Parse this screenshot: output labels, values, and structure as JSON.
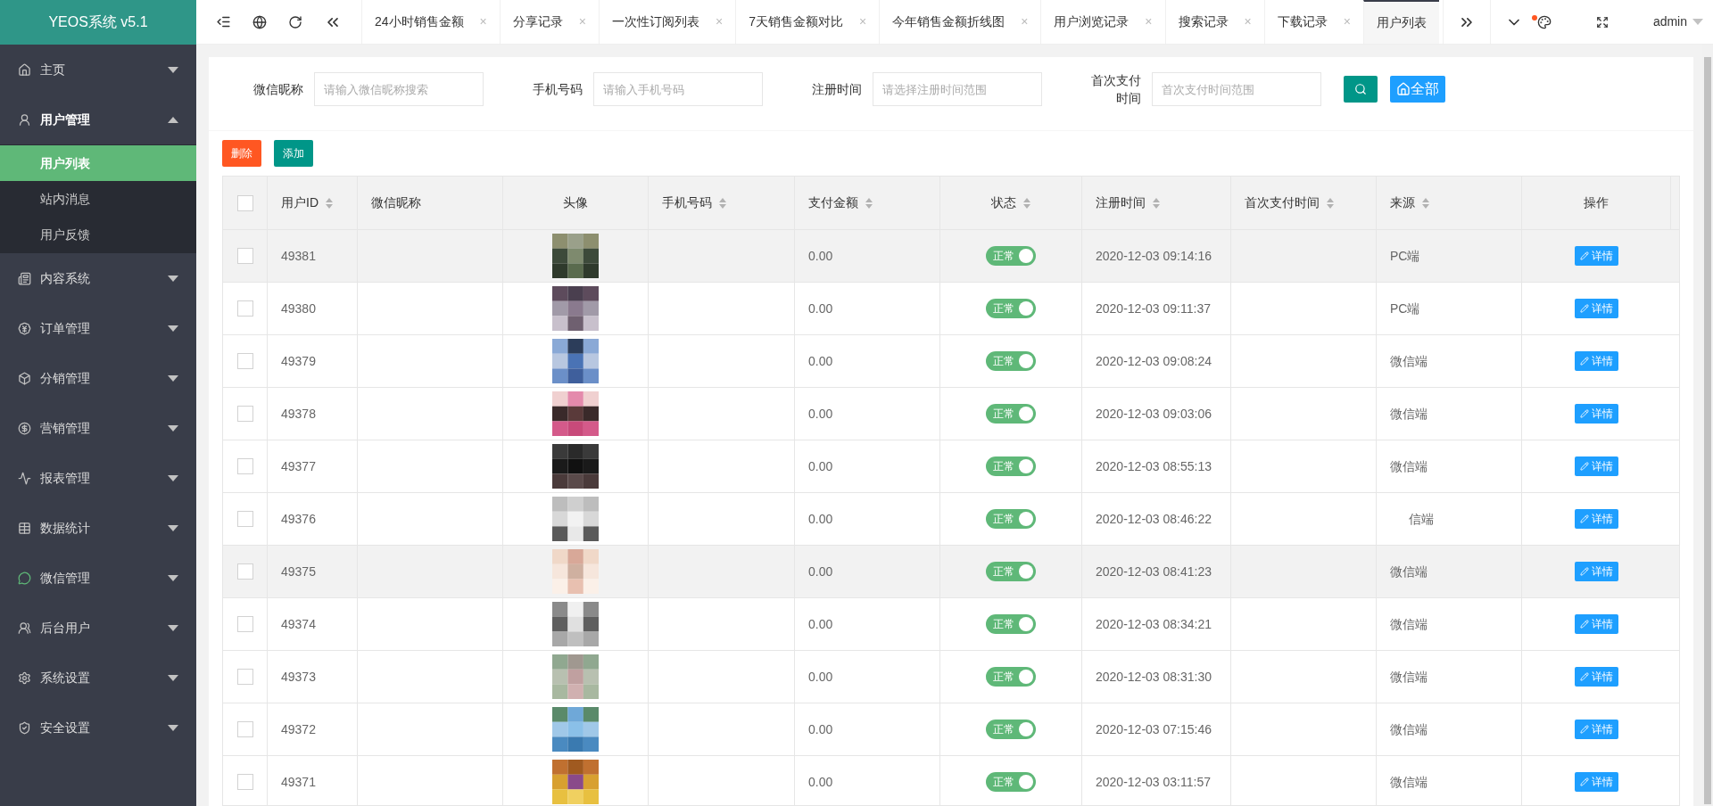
{
  "brand": "YEOS系统 v5.1",
  "sidebar": {
    "items": [
      {
        "label": "主页",
        "expanded": false
      },
      {
        "label": "用户管理",
        "expanded": true,
        "children": [
          {
            "label": "用户列表",
            "selected": true
          },
          {
            "label": "站内消息",
            "selected": false
          },
          {
            "label": "用户反馈",
            "selected": false
          }
        ]
      },
      {
        "label": "内容系统",
        "expanded": false
      },
      {
        "label": "订单管理",
        "expanded": false
      },
      {
        "label": "分销管理",
        "expanded": false
      },
      {
        "label": "营销管理",
        "expanded": false
      },
      {
        "label": "报表管理",
        "expanded": false
      },
      {
        "label": "数据统计",
        "expanded": false
      },
      {
        "label": "微信管理",
        "expanded": false
      },
      {
        "label": "后台用户",
        "expanded": false
      },
      {
        "label": "系统设置",
        "expanded": false
      },
      {
        "label": "安全设置",
        "expanded": false
      }
    ]
  },
  "tabs": [
    {
      "label": "24小时销售金额",
      "selected": false
    },
    {
      "label": "分享记录",
      "selected": false
    },
    {
      "label": "一次性订阅列表",
      "selected": false
    },
    {
      "label": "7天销售金额对比",
      "selected": false
    },
    {
      "label": "今年销售金额折线图",
      "selected": false
    },
    {
      "label": "用户浏览记录",
      "selected": false
    },
    {
      "label": "搜索记录",
      "selected": false
    },
    {
      "label": "下载记录",
      "selected": false
    },
    {
      "label": "用户列表",
      "selected": true
    }
  ],
  "tab_close": "×",
  "user": "admin",
  "filters": [
    {
      "label": "微信昵称",
      "placeholder": "请输入微信昵称搜索"
    },
    {
      "label": "手机号码",
      "placeholder": "请输入手机号码"
    },
    {
      "label": "注册时间",
      "placeholder": "请选择注册时间范围"
    },
    {
      "label": "首次支付时间",
      "placeholder": "首次支付时间范围"
    }
  ],
  "all_button": "全部",
  "actions": [
    {
      "label": "删除",
      "kind": "danger"
    },
    {
      "label": "添加",
      "kind": "primary"
    }
  ],
  "table": {
    "columns": [
      {
        "label": "用户ID",
        "sortable": true
      },
      {
        "label": "微信昵称",
        "sortable": false
      },
      {
        "label": "头像",
        "sortable": false
      },
      {
        "label": "手机号码",
        "sortable": true
      },
      {
        "label": "支付金额",
        "sortable": true
      },
      {
        "label": "状态",
        "sortable": true
      },
      {
        "label": "注册时间",
        "sortable": true
      },
      {
        "label": "首次支付时间",
        "sortable": true
      },
      {
        "label": "来源",
        "sortable": true
      },
      {
        "label": "操作",
        "sortable": false
      }
    ],
    "rows": [
      {
        "id": "49381",
        "amount": "0.00",
        "status": "正常",
        "on": true,
        "registered": "2020-12-03 09:14:16",
        "source": "PC端",
        "highlighted": true,
        "checked": false,
        "action": "详情"
      },
      {
        "id": "49380",
        "amount": "0.00",
        "status": "正常",
        "on": true,
        "registered": "2020-12-03 09:11:37",
        "source": "PC端",
        "highlighted": false,
        "checked": false,
        "action": "详情"
      },
      {
        "id": "49379",
        "amount": "0.00",
        "status": "正常",
        "on": true,
        "registered": "2020-12-03 09:08:24",
        "source": "微信端",
        "highlighted": false,
        "checked": false,
        "action": "详情"
      },
      {
        "id": "49378",
        "amount": "0.00",
        "status": "正常",
        "on": true,
        "registered": "2020-12-03 09:03:06",
        "source": "微信端",
        "highlighted": false,
        "checked": false,
        "action": "详情"
      },
      {
        "id": "49377",
        "amount": "0.00",
        "status": "正常",
        "on": true,
        "registered": "2020-12-03 08:55:13",
        "source": "微信端",
        "highlighted": false,
        "checked": false,
        "action": "详情"
      },
      {
        "id": "49376",
        "amount": "0.00",
        "status": "正常",
        "on": true,
        "registered": "2020-12-03 08:46:22",
        "source": "信端",
        "highlighted": false,
        "checked": false,
        "action": "详情"
      },
      {
        "id": "49375",
        "amount": "0.00",
        "status": "正常",
        "on": true,
        "registered": "2020-12-03 08:41:23",
        "source": "微信端",
        "highlighted": true,
        "checked": false,
        "action": "详情"
      },
      {
        "id": "49374",
        "amount": "0.00",
        "status": "正常",
        "on": true,
        "registered": "2020-12-03 08:34:21",
        "source": "微信端",
        "highlighted": false,
        "checked": false,
        "action": "详情"
      },
      {
        "id": "49373",
        "amount": "0.00",
        "status": "正常",
        "on": true,
        "registered": "2020-12-03 08:31:30",
        "source": "微信端",
        "highlighted": false,
        "checked": false,
        "action": "详情"
      },
      {
        "id": "49372",
        "amount": "0.00",
        "status": "正常",
        "on": true,
        "registered": "2020-12-03 07:15:46",
        "source": "微信端",
        "highlighted": false,
        "checked": false,
        "action": "详情"
      },
      {
        "id": "49371",
        "amount": "0.00",
        "status": "正常",
        "on": true,
        "registered": "2020-12-03 03:11:57",
        "source": "微信端",
        "highlighted": false,
        "checked": false,
        "action": "详情"
      }
    ],
    "select_all_checked": false
  }
}
